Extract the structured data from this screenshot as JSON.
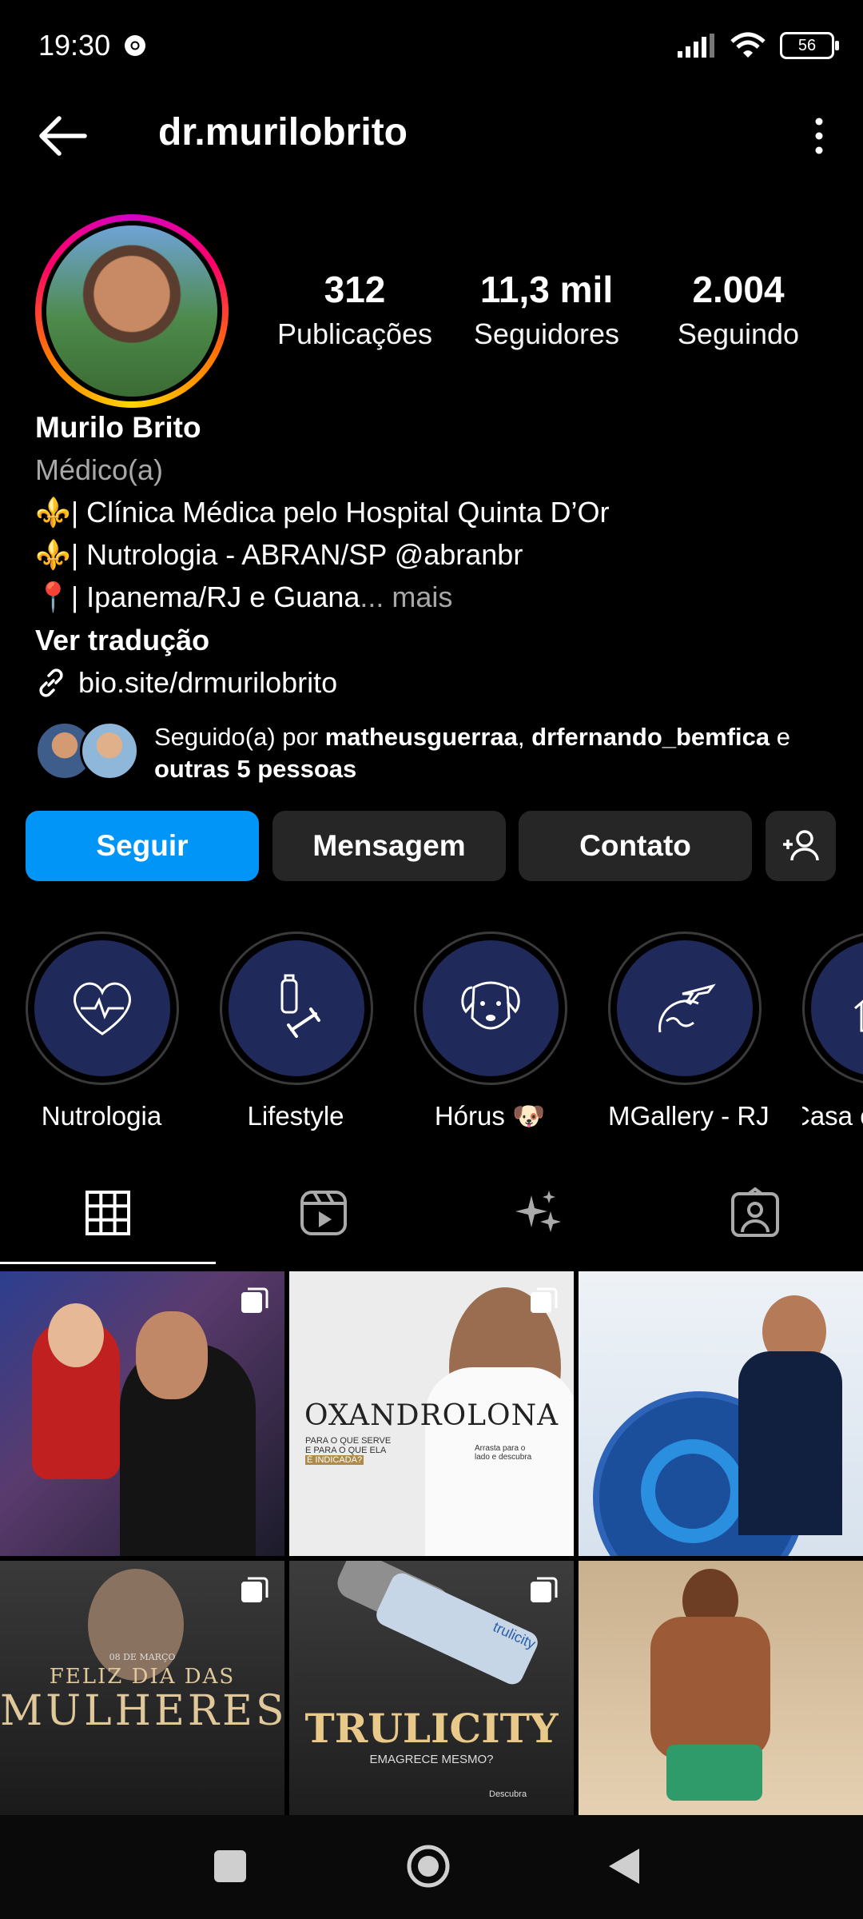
{
  "status_bar": {
    "time": "19:30",
    "battery": "56"
  },
  "header": {
    "username": "dr.murilobrito"
  },
  "stats": [
    {
      "value": "312",
      "label": "Publicações"
    },
    {
      "value": "11,3 mil",
      "label": "Seguidores"
    },
    {
      "value": "2.004",
      "label": "Seguindo"
    }
  ],
  "bio": {
    "name": "Murilo Brito",
    "category": "Médico(a)",
    "line1_emoji": "⚜️",
    "line1": "| Clínica Médica pelo Hospital Quinta D’Or",
    "line2_emoji": "⚜️",
    "line2": "| Nutrologia - ABRAN/SP @abranbr",
    "line3_emoji": "📍",
    "line3": "| Ipanema/RJ  e Guana",
    "line3_more": "... mais",
    "translate": "Ver tradução",
    "link": "bio.site/drmurilobrito"
  },
  "followed_by": {
    "prefix": "Seguido(a) por ",
    "user1": "matheusguerraa",
    "sep": ", ",
    "user2": "drfernando_bemfica",
    "suffix": " e",
    "others": "outras 5 pessoas"
  },
  "buttons": {
    "follow": "Seguir",
    "message": "Mensagem",
    "contact": "Contato"
  },
  "highlights": [
    {
      "label": "Nutrologia",
      "icon": "heart-pulse-icon"
    },
    {
      "label": "Lifestyle",
      "icon": "fitness-icon"
    },
    {
      "label": "Hórus 🐶",
      "icon": "dog-icon"
    },
    {
      "label": "MGallery - RJ",
      "icon": "travel-icon"
    },
    {
      "label": "Casa c",
      "icon": "house-icon"
    }
  ],
  "posts": {
    "p2_title": "OXANDROLONA",
    "p2_sub1": "PARA O QUE SERVE",
    "p2_sub2": "E PARA O QUE ELA",
    "p2_sub3": "É INDICADA?",
    "p2_swipe1": "Arrasta para o",
    "p2_swipe2": "lado e descubra",
    "p4_date": "08 DE MARÇO",
    "p4_title1": "FELIZ DIA DAS",
    "p4_title2": "MULHERES",
    "p5_title": "TRULICITY",
    "p5_sub": "EMAGRECE MESMO?",
    "p5_swipe": "Descubra",
    "p5_brand": "trulicity"
  },
  "colors": {
    "accent": "#0095f6",
    "button_bg": "#262626",
    "highlight_bg": "#1f2a5a"
  }
}
